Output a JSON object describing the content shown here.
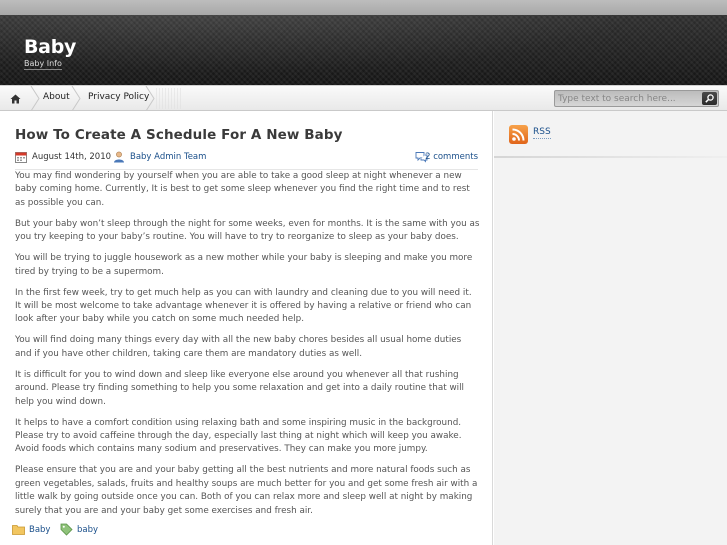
{
  "site": {
    "title": "Baby",
    "description": "Baby Info"
  },
  "nav": {
    "home_icon": "home-icon",
    "items": [
      {
        "label": "About"
      },
      {
        "label": "Privacy Policy"
      }
    ]
  },
  "search": {
    "placeholder": "Type text to search here...",
    "button_icon": "magnifier-icon"
  },
  "post": {
    "title": "How To Create A Schedule For A New Baby",
    "date": "August 14th, 2010",
    "author": "Baby Admin Team",
    "comments": "2 comments",
    "paragraphs": [
      "You may find wondering by yourself when you are able to take a good sleep at night whenever a new baby coming home. Currently, It is best to get some sleep whenever you find the right time and to rest as possible you can.",
      "But your baby won’t sleep through the night for some weeks, even for months. It is the same with you as you try keeping to your baby’s routine. You will have to try to reorganize to sleep as your baby does.",
      "You will be trying to juggle housework as a new mother while your baby is sleeping and make you more tired by trying to be a supermom.",
      "In the first few week, try to get much help as you can with laundry and cleaning due to you will need it. It will be most welcome to take advantage whenever it is offered by having a relative or friend who can look after your baby while you catch on some much needed help.",
      "You will find doing many things every day with all the new baby chores besides all usual home duties and if you have other children, taking care them are mandatory duties as well.",
      "It is difficult for you to wind down and sleep like everyone else around you whenever all that rushing around. Please try finding something to help you some relaxation and get into a daily routine that will help you wind down.",
      "It helps to have a comfort condition using relaxing bath and some inspiring music in the background. Please try to avoid caffeine through the day, especially last thing at night which will keep you awake. Avoid foods which contains many sodium and preservatives. They can make you more jumpy.",
      "Please ensure that you are and your baby getting all the best nutrients and more natural foods such as green vegetables, salads, fruits and healthy soups are much better for you and get some fresh air with a little walk by going outside once you can. Both of you can relax more and sleep well at night by making surely that you are and your baby get some exercises and fresh air."
    ],
    "category": "Baby",
    "tag": "baby"
  },
  "sidebar": {
    "rss_label": "RSS"
  },
  "colors": {
    "link": "#1a4f8a",
    "header_bg": "#1f1f1f",
    "rss": "#e0641a"
  }
}
